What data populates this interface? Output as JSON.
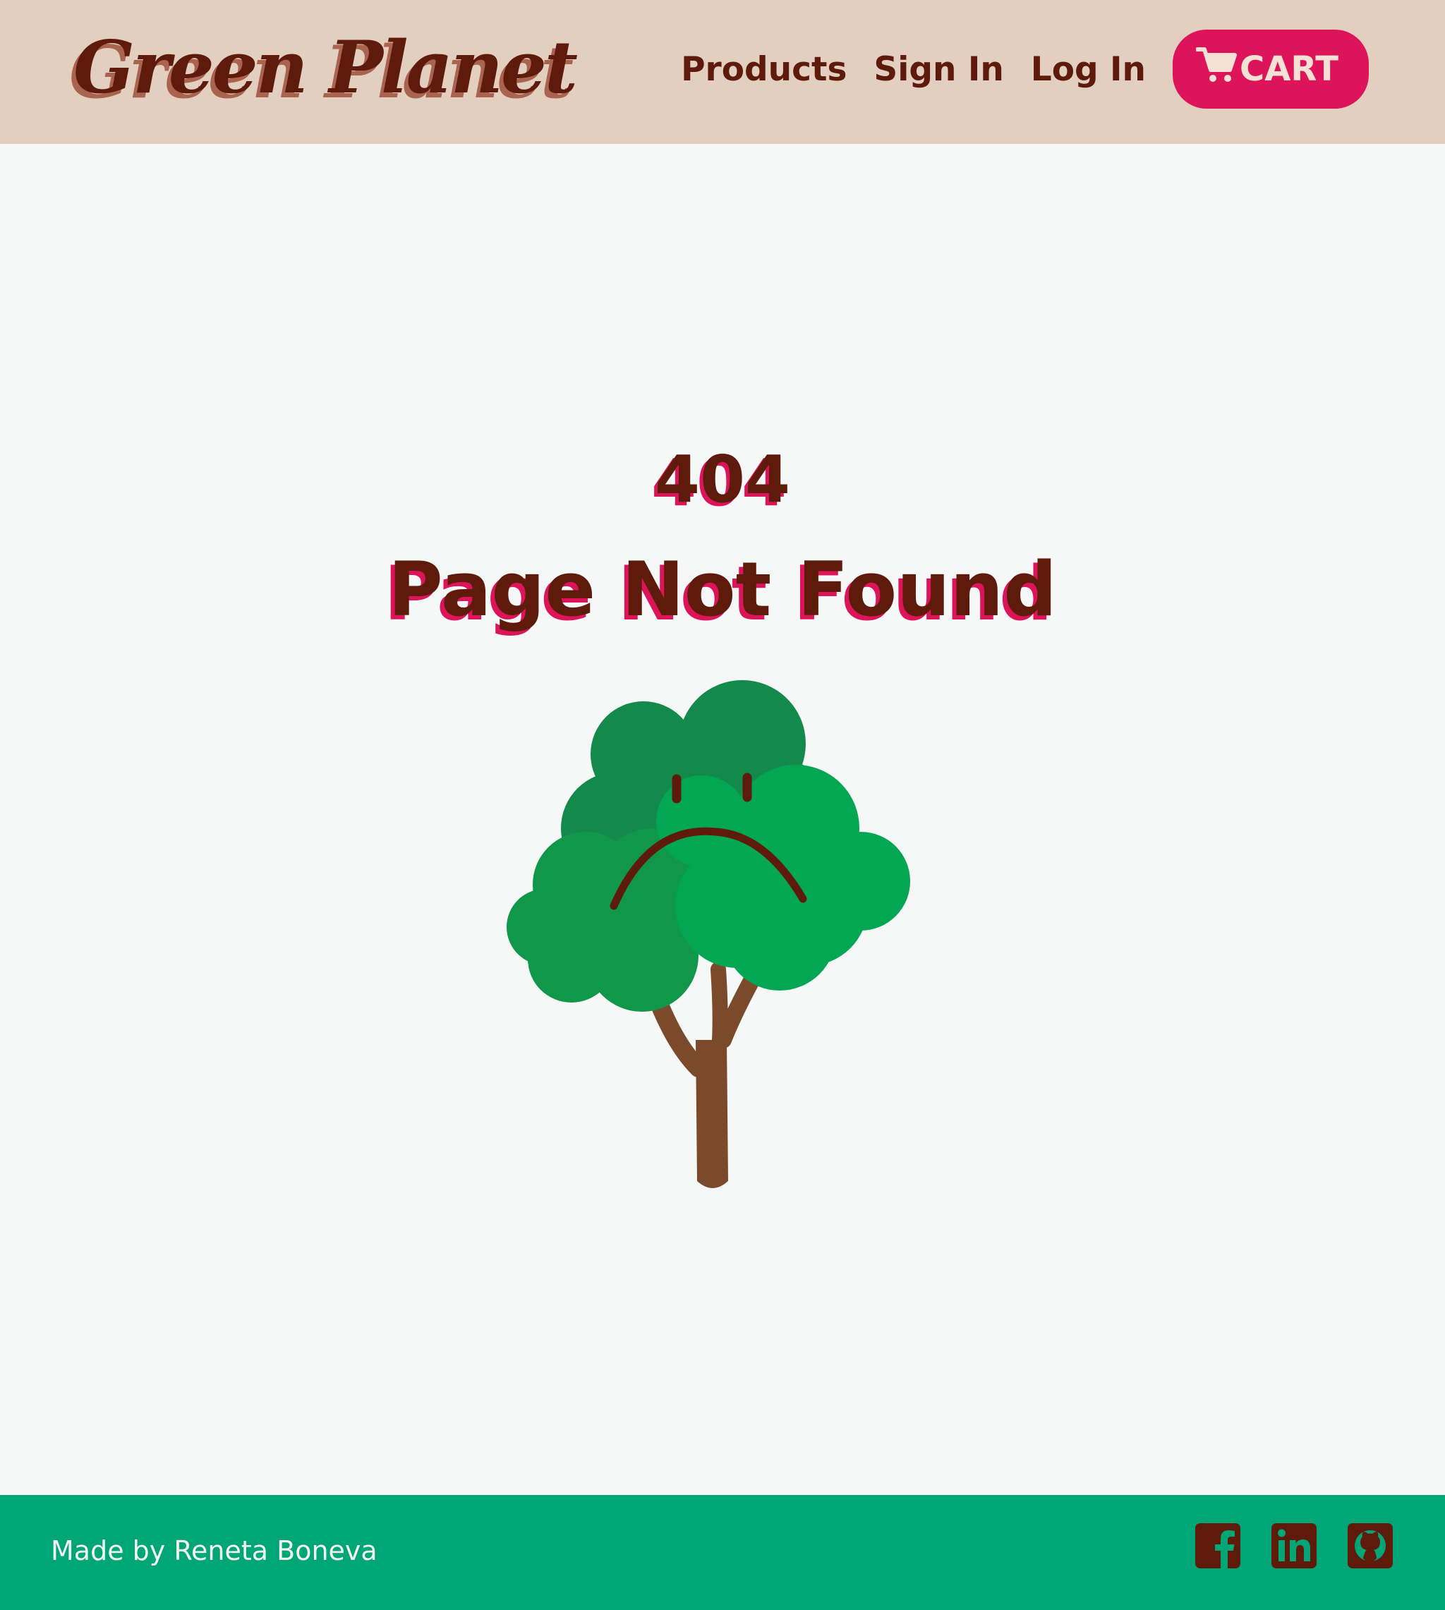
{
  "brand": {
    "name": "Green Planet"
  },
  "nav": {
    "items": [
      {
        "label": "Products"
      },
      {
        "label": "Sign In"
      },
      {
        "label": "Log In"
      }
    ],
    "cart_label": "CART"
  },
  "error": {
    "code": "404",
    "message": "Page Not Found"
  },
  "footer": {
    "credit": "Made by Reneta Boneva",
    "social": [
      "facebook-icon",
      "linkedin-icon",
      "github-icon"
    ]
  },
  "colors": {
    "header_bg": "#e2cfc0",
    "text_brown": "#5e1a0b",
    "accent_pink": "#dd145a",
    "footer_green": "#00a676",
    "page_bg": "#f6f8f7"
  }
}
